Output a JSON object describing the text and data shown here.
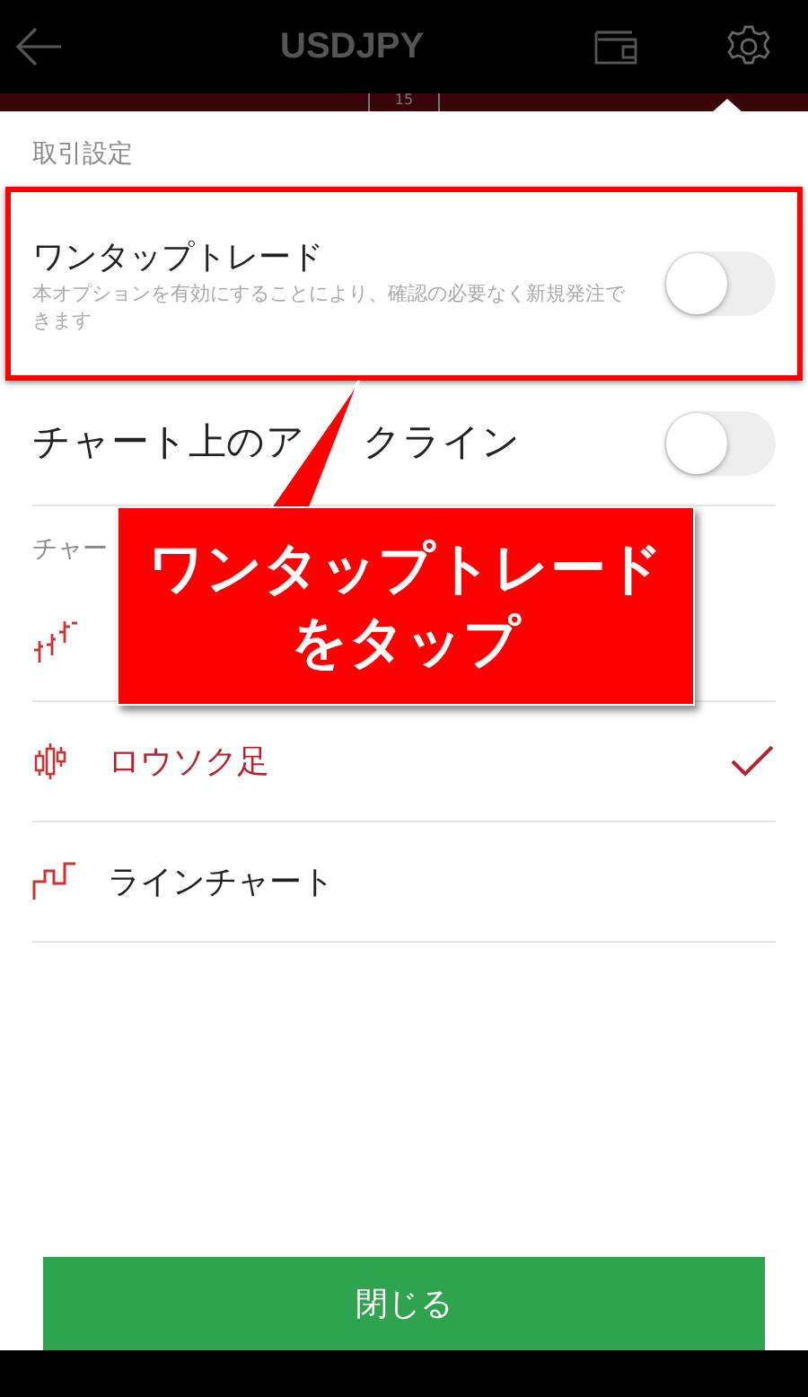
{
  "header": {
    "title": "USDJPY",
    "tab_peek": "15"
  },
  "trade_settings": {
    "heading": "取引設定",
    "toggles": [
      {
        "label": "ワンタップトレード",
        "description": "本オプションを有効にすることにより、確認の必要なく新規発注できます",
        "on": false,
        "highlighted": true
      },
      {
        "label_visible_parts": [
          "チャート上のア",
          "クライン"
        ],
        "on": false,
        "highlighted": false
      }
    ]
  },
  "chart_settings": {
    "heading": "チャー",
    "types": [
      {
        "kind": "bar",
        "selected": false
      },
      {
        "kind": "candle",
        "label": "ロウソク足",
        "selected": true
      },
      {
        "kind": "line",
        "label": "ラインチャート",
        "selected": false
      }
    ]
  },
  "callout": {
    "lines": [
      "ワンタップトレード",
      "をタップ"
    ]
  },
  "close_button": "閉じる"
}
